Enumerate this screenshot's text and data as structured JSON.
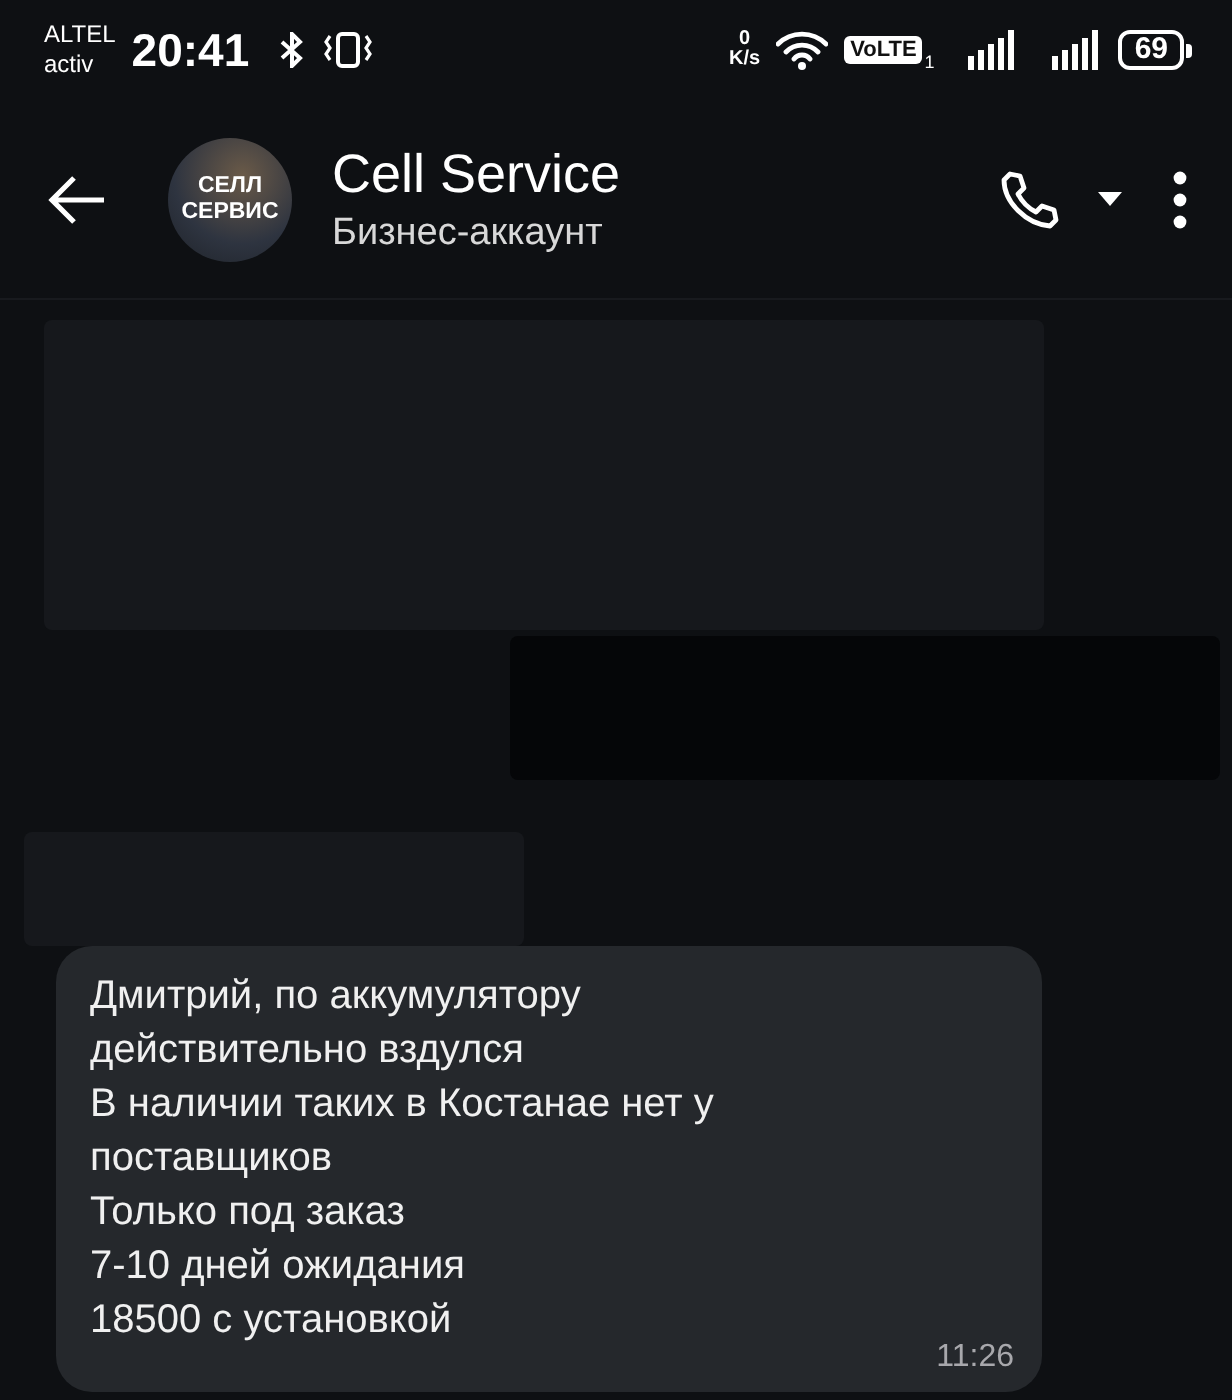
{
  "status_bar": {
    "carrier": [
      "ALTEL",
      "activ"
    ],
    "time": "20:41",
    "net_speed_value": "0",
    "net_speed_unit": "K/s",
    "volte": "VoLTE",
    "volte_sim": "1",
    "battery": "69"
  },
  "header": {
    "avatar_text": [
      "СЕЛЛ",
      "СЕРВИС"
    ],
    "title": "Cell Service",
    "subtitle": "Бизнес-аккаунт"
  },
  "messages": [
    {
      "kind": "redacted"
    },
    {
      "kind": "text",
      "lines": [
        "Дмитрий, по аккумулятору",
        "действительно вздулся",
        "В наличии таких в Костанае нет у",
        "поставщиков",
        "Только под заказ",
        "7-10 дней ожидания",
        "18500 с установкой"
      ],
      "time": "11:26"
    }
  ]
}
